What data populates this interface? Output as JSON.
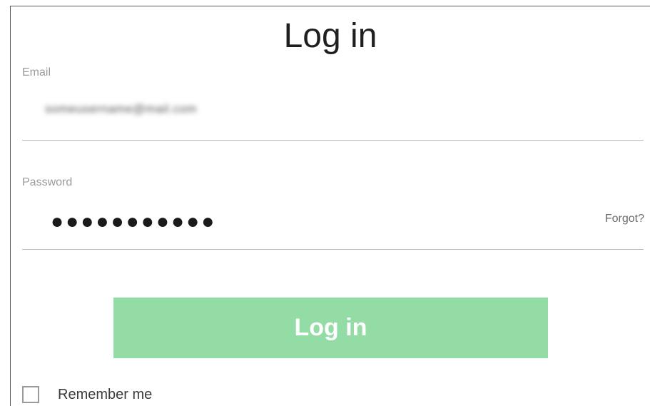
{
  "form": {
    "title": "Log in",
    "email": {
      "label": "Email",
      "value": "someusername@mail.com"
    },
    "password": {
      "label": "Password",
      "masked_value": "●●●●●●●●●●●",
      "forgot_link": "Forgot?"
    },
    "submit_label": "Log in",
    "remember_me": {
      "label": "Remember me",
      "checked": false
    }
  },
  "colors": {
    "button_bg": "#93dca6",
    "label": "#9b9b9b",
    "divider": "#b8b8b8"
  }
}
